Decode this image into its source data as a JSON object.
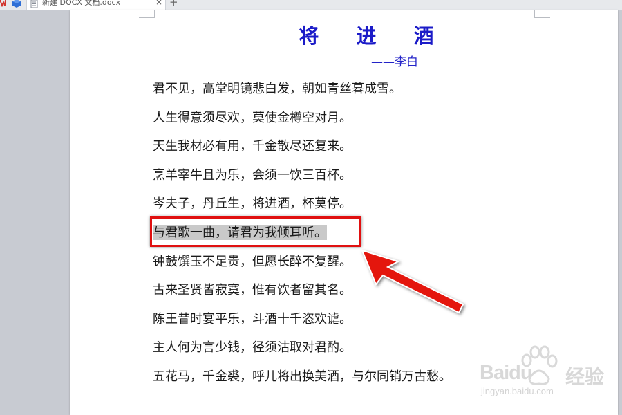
{
  "tabs": {
    "active_title": "新建 DOCX 文档.docx",
    "close_glyph": "×",
    "new_tab_glyph": "+"
  },
  "document": {
    "title": "将 进 酒",
    "author": "——李白",
    "lines": [
      "君不见，高堂明镜悲白发，朝如青丝暮成雪。",
      "人生得意须尽欢，莫使金樽空对月。",
      "天生我材必有用，千金散尽还复来。",
      "烹羊宰牛且为乐，会须一饮三百杯。",
      "岑夫子，丹丘生，将进酒，杯莫停。",
      "与君歌一曲，请君为我倾耳听。",
      "钟鼓馔玉不足贵，但愿长醉不复醒。",
      "古来圣贤皆寂寞，惟有饮者留其名。",
      "陈王昔时宴平乐，斗酒十千恣欢谑。",
      "主人何为言少钱，径须沽取对君酌。",
      "五花马，千金裘，呼儿将出换美酒，与尔同销万古愁。"
    ],
    "selected_line_index": 5
  },
  "colors": {
    "title": "#1b1bc8",
    "author": "#2323c8",
    "selection": "#c9c9c9",
    "annotation": "#e01010"
  },
  "icons": {
    "app_logo": "wps-logo-icon",
    "cube": "cube-icon",
    "doc": "document-icon"
  },
  "watermark": {
    "brand": "Baidu",
    "brand_cn": "经验",
    "url": "jingyan.baidu.com"
  }
}
